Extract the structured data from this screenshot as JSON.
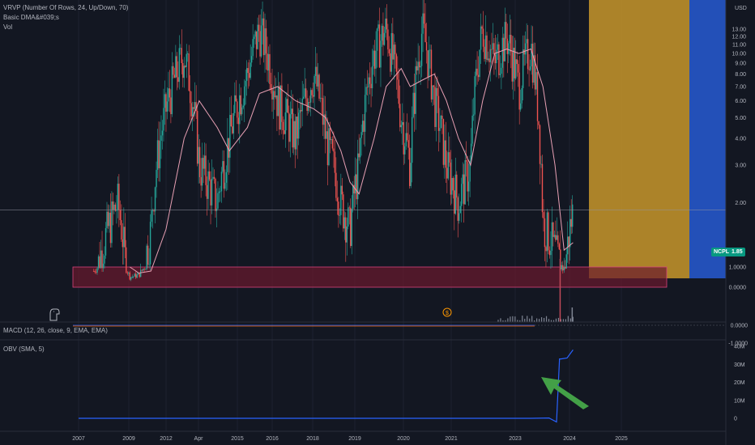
{
  "indicators": {
    "vrvp": "VRVP (Number Of Rows, 24, Up/Down, 70)",
    "dma": "Basic DMA&#039;s",
    "vol": "Vol",
    "macd": "MACD (12, 26, close, 9, EMA, EMA)",
    "obv": "OBV (SMA, 5)"
  },
  "price_tag": {
    "symbol": "NCPL",
    "value": "1.85"
  },
  "dividend_marker": "$",
  "colors": {
    "background": "#131722",
    "up": "#26a69a",
    "down": "#ef5350",
    "ma": "#e8a0b4",
    "zone_fill": "#6b1a2e",
    "zone_stroke": "#d8447c",
    "vrvp_up": "#c8962a",
    "vrvp_down": "#2656c9",
    "obv_line": "#2962ff",
    "arrow": "#43a047"
  },
  "chart_data": [
    {
      "type": "line",
      "name": "price-panel",
      "y_axis_unit": "USD",
      "y_scale": "log",
      "y_ticks": [
        "13.00",
        "12.00",
        "11.00",
        "10.00",
        "9.00",
        "8.00",
        "7.00",
        "6.00",
        "5.00",
        "4.00",
        "3.00",
        "2.00",
        "1.0000",
        "0.0000"
      ],
      "x_ticks": [
        "2007",
        "2009",
        "2012",
        "Apr",
        "2015",
        "2016",
        "2018",
        "2019",
        "2020",
        "2021",
        "2023",
        "2024",
        "2025"
      ],
      "x": [
        2007.5,
        2008.3,
        2008.7,
        2009.0,
        2009.4,
        2009.9,
        2010.5,
        2011.0,
        2011.6,
        2012.0,
        2012.6,
        2013.0,
        2013.6,
        2014.2,
        2014.8,
        2015.2,
        2015.7,
        2016.0,
        2016.3,
        2016.8,
        2017.2,
        2017.7,
        2018.0,
        2018.4,
        2018.8,
        2019.2,
        2019.6,
        2020.0,
        2020.4,
        2020.8,
        2021.2,
        2021.6,
        2022.0,
        2022.4,
        2022.8,
        2023.1,
        2023.4
      ],
      "close": [
        0.8,
        2.0,
        0.5,
        0.6,
        1.5,
        5.5,
        10.0,
        3.0,
        2.0,
        4.0,
        8.0,
        13.0,
        6.0,
        4.0,
        8.0,
        4.0,
        2.0,
        1.5,
        3.0,
        10.0,
        13.0,
        5.0,
        3.0,
        13.0,
        6.0,
        3.0,
        2.0,
        3.0,
        13.0,
        9.0,
        12.0,
        7.0,
        11.0,
        1.6,
        1.2,
        0.9,
        1.85
      ],
      "sma": [
        null,
        null,
        1.0,
        0.7,
        0.8,
        1.5,
        4.0,
        6.0,
        4.5,
        3.5,
        4.5,
        6.5,
        7.0,
        6.0,
        5.5,
        5.0,
        3.5,
        2.5,
        2.2,
        4.0,
        7.0,
        8.5,
        7.0,
        7.5,
        8.0,
        6.0,
        4.0,
        3.0,
        6.0,
        10.0,
        10.5,
        10.0,
        10.5,
        7.0,
        3.0,
        1.2,
        1.3
      ],
      "support_zone": [
        0.0,
        1.0
      ]
    },
    {
      "type": "bar",
      "name": "vrvp-profile",
      "series": [
        {
          "name": "Up",
          "values": [
            1
          ]
        },
        {
          "name": "Down",
          "values": [
            1
          ]
        }
      ]
    },
    {
      "type": "line",
      "name": "macd-panel",
      "y_ticks": [
        "-1.0000",
        "0.0000"
      ],
      "y_range": [
        -1.0,
        0.2
      ]
    },
    {
      "type": "line",
      "name": "obv-panel",
      "y_ticks": [
        "40M",
        "30M",
        "20M",
        "10M",
        "0"
      ],
      "x": [
        2007.0,
        2015.0,
        2022.0,
        2022.6,
        2022.85,
        2022.95,
        2023.0,
        2023.2,
        2023.4
      ],
      "values": [
        0.0,
        0.0,
        0.0,
        0.2,
        -2.0,
        33.0,
        33.0,
        33.5,
        38.0
      ]
    }
  ]
}
